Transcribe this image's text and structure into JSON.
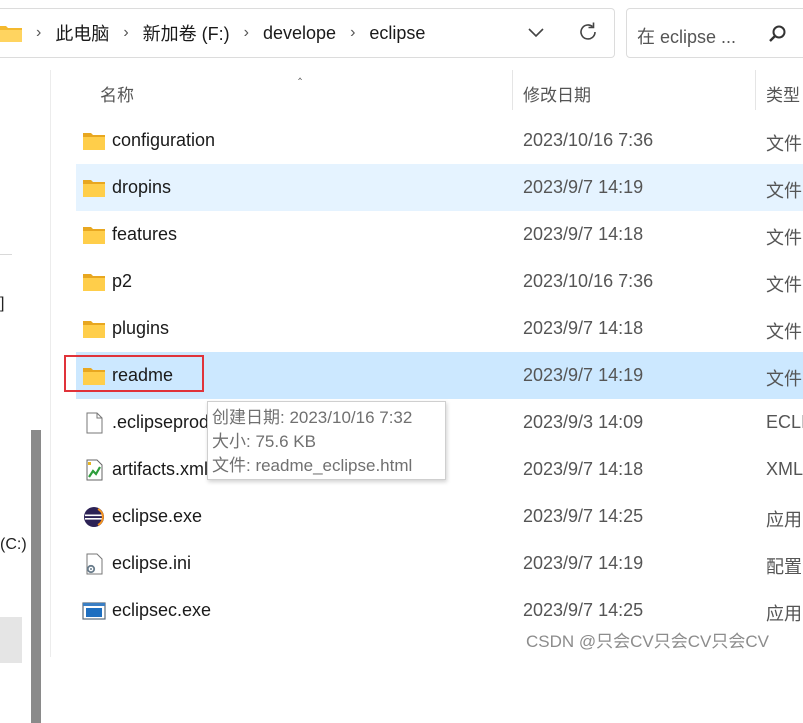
{
  "address_bar": {
    "crumbs": [
      "此电脑",
      "新加卷 (F:)",
      "develope",
      "eclipse"
    ]
  },
  "search": {
    "placeholder": "在 eclipse ..."
  },
  "nav": {
    "partial_label": "]",
    "drive_label": "(C:)"
  },
  "columns": {
    "name": "名称",
    "modified": "修改日期",
    "type": "类型"
  },
  "files": [
    {
      "name": "configuration",
      "modified": "2023/10/16 7:36",
      "type": "文件",
      "icon": "folder-icon"
    },
    {
      "name": "dropins",
      "modified": "2023/9/7 14:19",
      "type": "文件",
      "icon": "folder-icon"
    },
    {
      "name": "features",
      "modified": "2023/9/7 14:18",
      "type": "文件",
      "icon": "folder-icon"
    },
    {
      "name": "p2",
      "modified": "2023/10/16 7:36",
      "type": "文件",
      "icon": "folder-icon"
    },
    {
      "name": "plugins",
      "modified": "2023/9/7 14:18",
      "type": "文件",
      "icon": "folder-icon"
    },
    {
      "name": "readme",
      "modified": "2023/9/7 14:19",
      "type": "文件",
      "icon": "folder-icon"
    },
    {
      "name": ".eclipseproduct",
      "modified": "2023/9/3 14:09",
      "type": "ECLI",
      "icon": "document-icon"
    },
    {
      "name": "artifacts.xml",
      "modified": "2023/9/7 14:18",
      "type": "XML",
      "icon": "xml-file-icon"
    },
    {
      "name": "eclipse.exe",
      "modified": "2023/9/7 14:25",
      "type": "应用",
      "icon": "eclipse-app-icon"
    },
    {
      "name": "eclipse.ini",
      "modified": "2023/9/7 14:19",
      "type": "配置",
      "icon": "config-file-icon"
    },
    {
      "name": "eclipsec.exe",
      "modified": "2023/9/7 14:25",
      "type": "应用",
      "icon": "console-app-icon"
    }
  ],
  "tooltip": {
    "created": "创建日期: 2023/10/16 7:32",
    "size": "大小: 75.6 KB",
    "files": "文件: readme_eclipse.html"
  },
  "watermark": "CSDN @只会CV只会CV只会CV",
  "colors": {
    "hover_row": "#e5f3ff",
    "selected_row": "#cce8ff",
    "highlight_border": "#e0333a",
    "folder": "#f8c84a"
  }
}
